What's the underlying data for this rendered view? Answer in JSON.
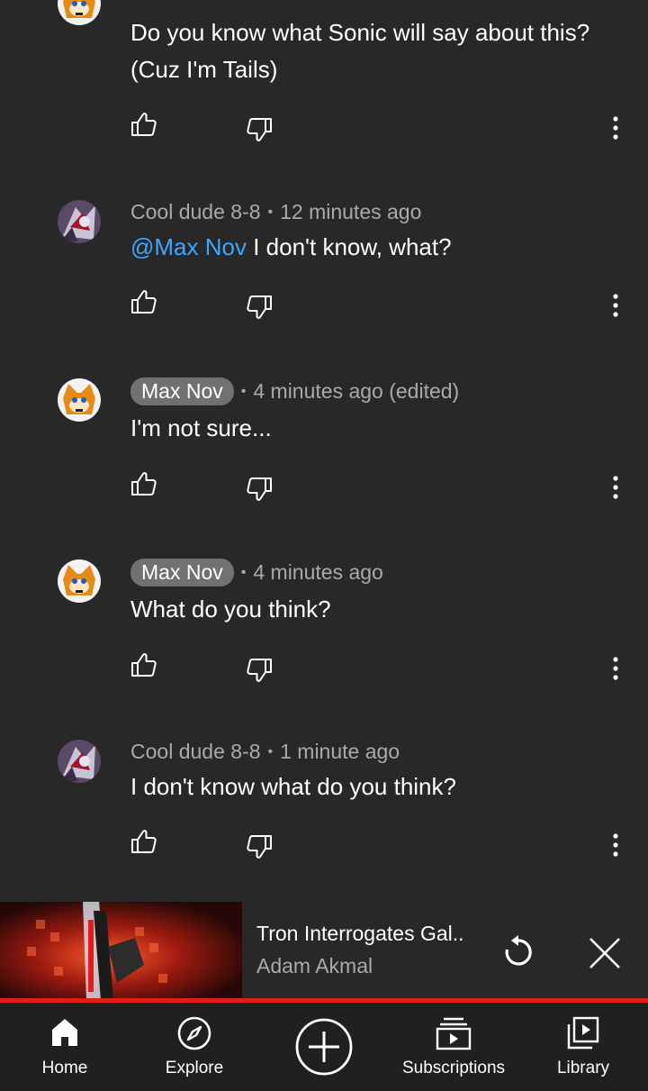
{
  "comments": [
    {
      "author": "",
      "author_chip": false,
      "time": "",
      "text_mention": "",
      "text": "Do you know what Sonic will say about this?",
      "text_line2": "(Cuz I'm Tails)"
    },
    {
      "author": "Cool dude 8-8",
      "author_chip": false,
      "time": "12 minutes ago",
      "text_mention": "@Max Nov",
      "text": "I don't know, what?"
    },
    {
      "author": "Max Nov",
      "author_chip": true,
      "time": "4 minutes ago (edited)",
      "text": "I'm not sure..."
    },
    {
      "author": "Max Nov",
      "author_chip": true,
      "time": "4 minutes ago",
      "text": "What do you think?"
    },
    {
      "author": "Cool dude 8-8",
      "author_chip": false,
      "time": "1 minute ago",
      "text": "I don't know what do you think?"
    }
  ],
  "separator": "•",
  "mini_player": {
    "title": "Tron Interrogates Gal..",
    "channel": "Adam Akmal"
  },
  "nav": {
    "home": "Home",
    "explore": "Explore",
    "subscriptions": "Subscriptions",
    "library": "Library"
  },
  "colors": {
    "background": "#282828",
    "mention": "#3ea6ff",
    "progress": "#e21b1b",
    "nav_bg": "#202020"
  }
}
